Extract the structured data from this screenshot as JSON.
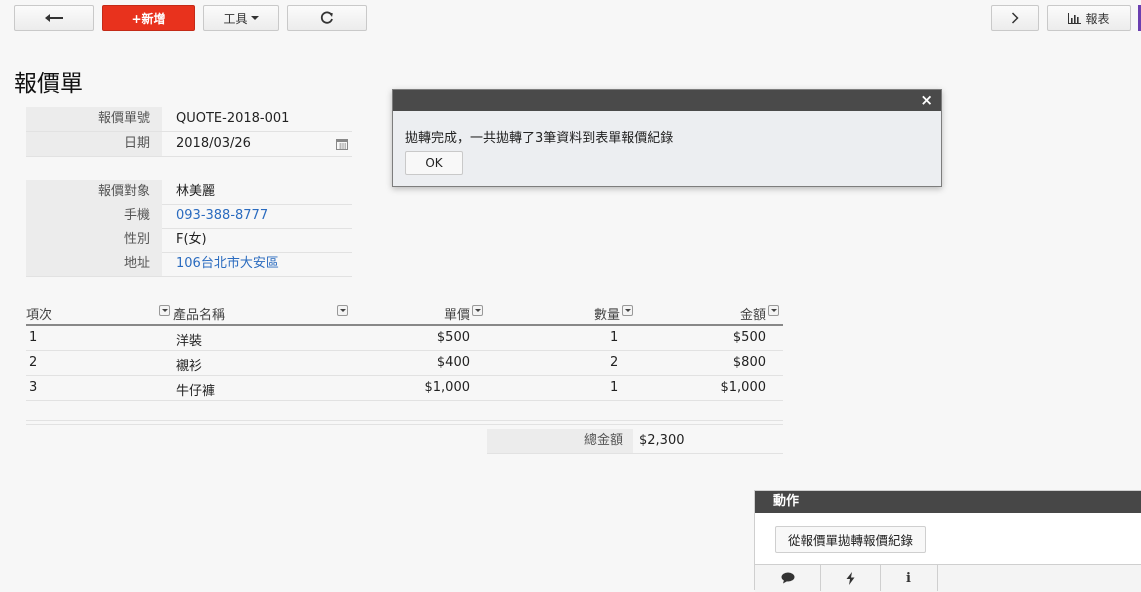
{
  "toolbar": {
    "new_label": "+新增",
    "tools_label": "工具",
    "report_label": "報表"
  },
  "page_title": "報價單",
  "quote": {
    "number_label": "報價單號",
    "number_value": "QUOTE-2018-001",
    "date_label": "日期",
    "date_value": "2018/03/26",
    "customer_label": "報價對象",
    "customer_value": "林美麗",
    "phone_label": "手機",
    "phone_value": "093-388-8777",
    "gender_label": "性別",
    "gender_value": "F(女)",
    "address_label": "地址",
    "address_value": "106台北市大安區"
  },
  "items_table": {
    "headers": [
      "項次",
      "產品名稱",
      "單價",
      "數量",
      "金額"
    ],
    "rows": [
      [
        "1",
        "洋裝",
        "$500",
        "1",
        "$500"
      ],
      [
        "2",
        "襯衫",
        "$400",
        "2",
        "$800"
      ],
      [
        "3",
        "牛仔褲",
        "$1,000",
        "1",
        "$1,000"
      ]
    ]
  },
  "total": {
    "label": "總金額",
    "value": "$2,300"
  },
  "dialog": {
    "close_glyph": "×",
    "message": "拋轉完成，一共拋轉了3筆資料到表單報價紀錄",
    "ok_label": "OK"
  },
  "actions_panel": {
    "title": "動作",
    "button_label": "從報價單拋轉報價紀錄",
    "info_glyph": "i"
  },
  "icons": [
    "back-arrow-icon",
    "caret-down-icon",
    "refresh-icon",
    "chevron-right-icon",
    "bar-chart-icon",
    "calendar-icon",
    "dropdown-icon",
    "comment-icon",
    "bolt-icon",
    "info-icon"
  ],
  "colors": {
    "primary_button": "#e8321d",
    "link": "#2a6bbf",
    "dialog_bar": "#4a4a4a",
    "panel_header": "#474747"
  }
}
